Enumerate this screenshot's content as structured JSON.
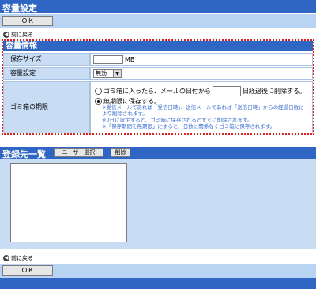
{
  "page": {
    "title": "容量設定",
    "ok_label": "ＯＫ",
    "back_label": "前に戻る"
  },
  "capacity": {
    "title": "容量情報",
    "save_size_label": "保存サイズ",
    "save_size_unit": "MB",
    "save_size_value": "",
    "capacity_setting_label": "容量設定",
    "capacity_setting_value": "無効",
    "trash_period_label": "ゴミ箱の期限",
    "option_delete_prefix": "ゴミ箱に入ったら、メールの日付から",
    "option_delete_suffix": "日経過後に削除する。",
    "option_delete_days": "",
    "option_keep": "無期限に保存する。",
    "note_1": "※受信メールであれば「受信日時」、送信メールであれば「送信日時」からの経過日数により削除されます。",
    "note_2": "※0日に設定すると、ゴミ箱に保存されるとすぐに削除されます。",
    "note_3": "※「保存期間を無期限」にすると、日数に関係なくゴミ箱に保存されます。"
  },
  "registration": {
    "title": "登録先一覧",
    "select_user_label": "ユーザー選択",
    "delete_label": "削除"
  }
}
